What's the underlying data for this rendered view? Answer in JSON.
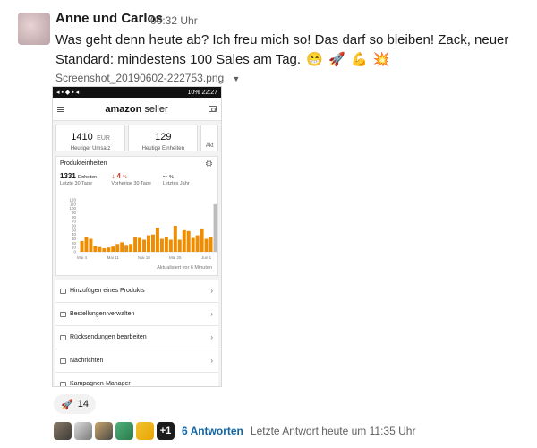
{
  "message": {
    "author": "Anne und Carlos",
    "time": "00:32 Uhr",
    "text": "Was geht denn heute ab? Ich freu mich so! Das darf so bleiben! Zack, neuer Standard: mindestens 100 Sales am Tag.",
    "emojis": [
      "😁",
      "🚀",
      "💪",
      "💥"
    ]
  },
  "attachment": {
    "filename": "Screenshot_20190602-222753.png",
    "caret_icon": "caret-down-icon"
  },
  "phone": {
    "status_right": "10% 22:27",
    "logo_brand": "amazon",
    "logo_suffix": "seller",
    "tiles": [
      {
        "value": "1410",
        "unit": "EUR",
        "label": "Heutiger Umsatz"
      },
      {
        "value": "129",
        "unit": "",
        "label": "Heutige Einheiten"
      },
      {
        "value": "",
        "unit": "",
        "label": "Akt"
      }
    ],
    "card": {
      "title": "Produkteinheiten",
      "stats": [
        {
          "value": "1331",
          "unit": "Einheiten",
          "label": "Letzte 30 Tage",
          "color": "#111111"
        },
        {
          "value": "↓ 4",
          "unit": "%",
          "label": "Vorherige 30 Tage",
          "color": "#c7372f"
        },
        {
          "value": "--",
          "unit": "%",
          "label": "Letztes Jahr",
          "color": "#111111"
        }
      ],
      "updated": "Aktualisiert vor 6 Minuten"
    },
    "menu": [
      "Hinzufügen eines Produkts",
      "Bestellungen verwalten",
      "Rücksendungen bearbeiten",
      "Nachrichten",
      "Kampagnen-Manager"
    ]
  },
  "chart_data": {
    "type": "bar",
    "title": "Produkteinheiten",
    "xlabel": "",
    "ylabel": "",
    "ylim": [
      0,
      120
    ],
    "yticks": [
      0,
      10,
      20,
      30,
      40,
      50,
      60,
      70,
      80,
      90,
      100,
      110,
      120
    ],
    "xtick_labels": [
      "Mai 4",
      "Mai 11",
      "Mai 18",
      "Mai 25",
      "Jun 1"
    ],
    "bar_color": "#f08c00",
    "today_color": "#bdbdbd",
    "values": [
      25,
      35,
      30,
      13,
      11,
      8,
      10,
      12,
      18,
      22,
      16,
      18,
      35,
      32,
      28,
      38,
      40,
      55,
      30,
      35,
      28,
      60,
      28,
      50,
      48,
      32,
      38,
      52,
      30,
      35,
      110
    ]
  },
  "reaction": {
    "emoji": "🚀",
    "count": "14"
  },
  "thread": {
    "extra_count": "+1",
    "replies": "6 Antworten",
    "last_reply": "Letzte Antwort heute um 11:35 Uhr"
  },
  "colors": {
    "link": "#1264a3",
    "muted": "#616061"
  }
}
